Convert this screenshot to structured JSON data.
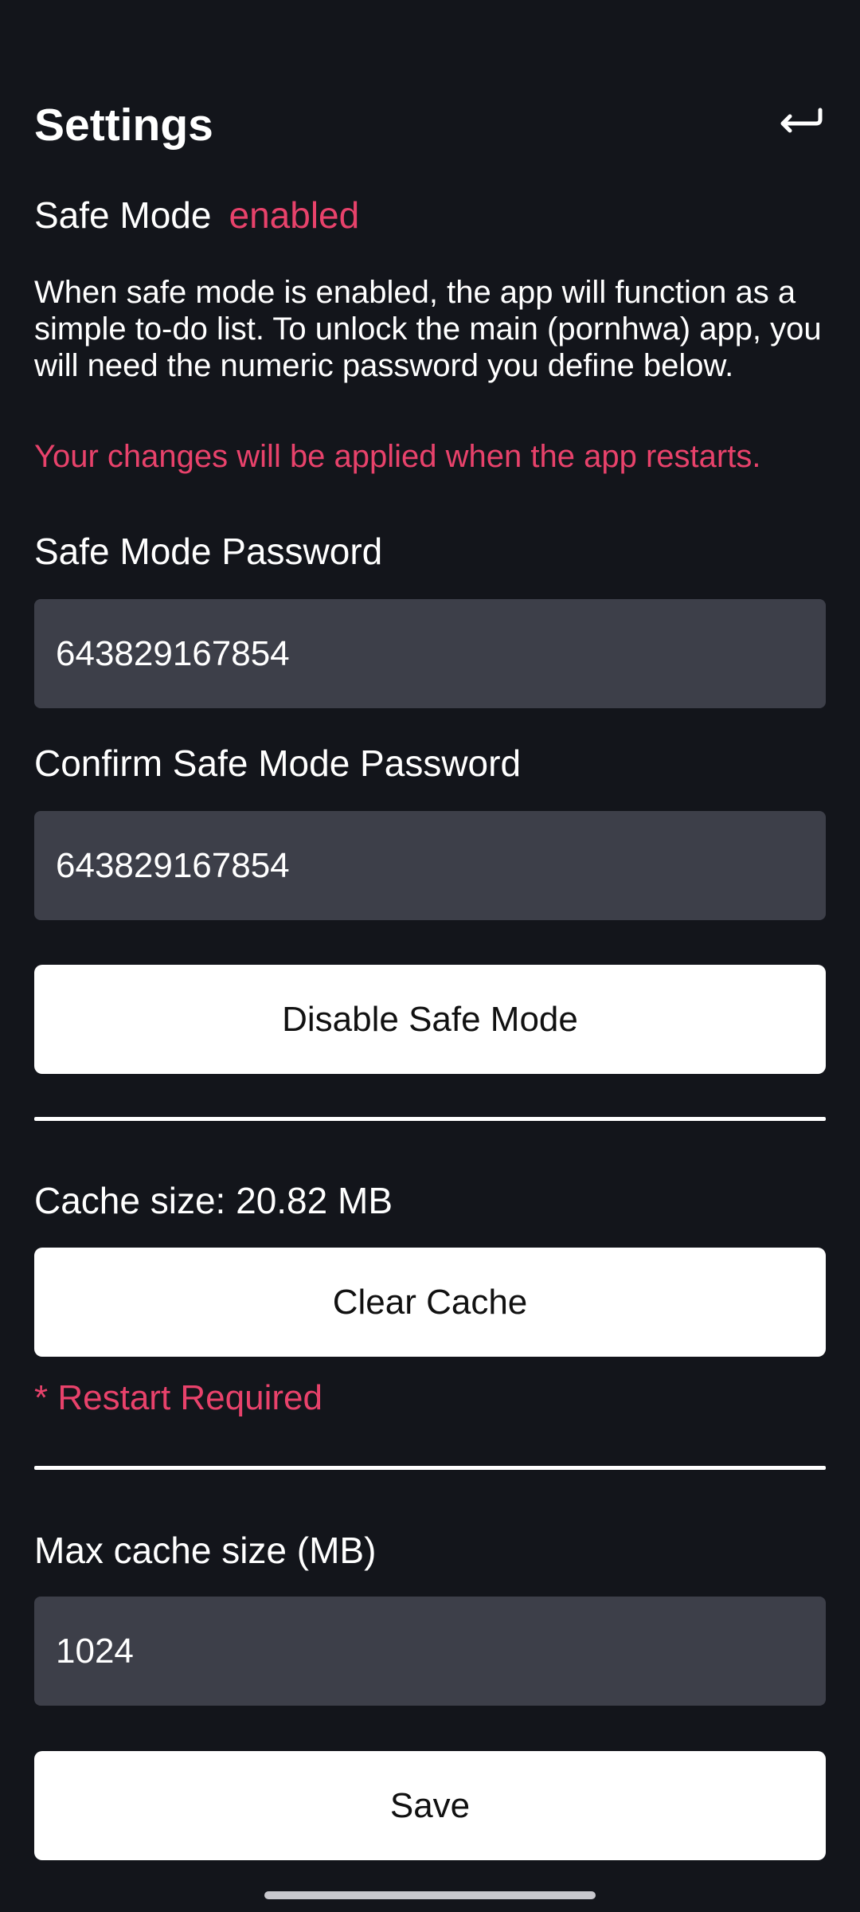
{
  "header": {
    "title": "Settings",
    "back_icon": "return-arrow-icon"
  },
  "safe_mode": {
    "label": "Safe Mode",
    "status": "enabled",
    "status_color": "#e8426b",
    "description": "When safe mode is enabled, the app will function as a simple to-do list. To unlock the main (pornhwa) app, you will need the numeric password you define below.",
    "warning": "Your changes will be applied when the app restarts.",
    "password_label": "Safe Mode Password",
    "password_value": "643829167854",
    "confirm_label": "Confirm Safe Mode Password",
    "confirm_value": "643829167854",
    "disable_button": "Disable Safe Mode"
  },
  "cache": {
    "size_text": "Cache size: 20.82 MB",
    "clear_button": "Clear Cache",
    "restart_note": "* Restart Required"
  },
  "max_cache": {
    "label": "Max cache size (MB)",
    "value": "1024",
    "save_button": "Save"
  },
  "colors": {
    "background": "#13151b",
    "input_background": "#3d3f49",
    "accent": "#e8426b",
    "button_background": "#ffffff"
  }
}
